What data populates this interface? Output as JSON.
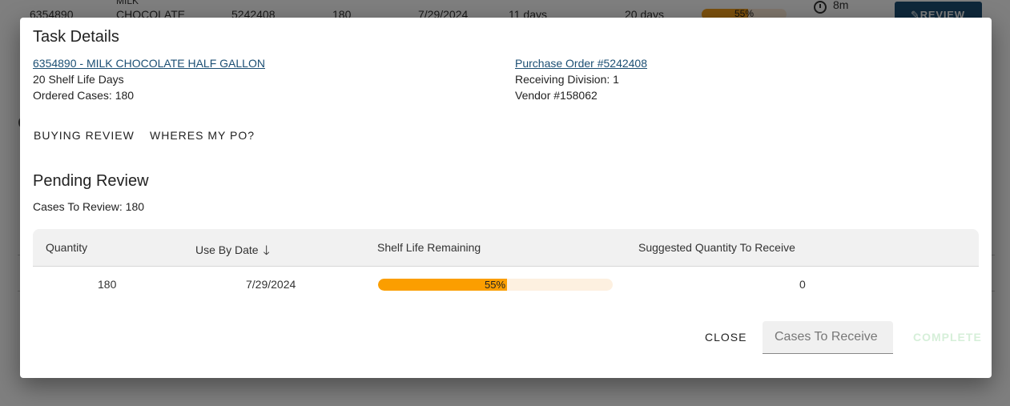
{
  "background": {
    "row": {
      "item_number": "6354890",
      "item_name_top": "MILK",
      "item_name": "CHOCOLATE",
      "po_number": "5242408",
      "cases": "180",
      "use_by_date": "7/29/2024",
      "days_remaining": "11 days",
      "shelf_life": "20 days",
      "shelf_life_percent_label": "55%",
      "shelf_life_fraction": 0.55,
      "timer": "8m",
      "review_label": "REVIEW"
    },
    "partial_letter": "C"
  },
  "dialog": {
    "title": "Task Details",
    "item_link": "6354890 - MILK CHOCOLATE HALF GALLON",
    "shelf_life_days": "20 Shelf Life Days",
    "ordered_cases": "Ordered Cases: 180",
    "po_link": "Purchase Order #5242408",
    "receiving_division": "Receiving Division: 1",
    "vendor": "Vendor #158062",
    "tabs": [
      "BUYING REVIEW",
      "WHERES MY PO?"
    ],
    "section_title": "Pending Review",
    "cases_to_review": "Cases To Review: 180",
    "table": {
      "headers": {
        "quantity": "Quantity",
        "use_by_date": "Use By Date",
        "shelf_life_remaining": "Shelf Life Remaining",
        "suggested_quantity": "Suggested Quantity To Receive"
      },
      "rows": [
        {
          "quantity": "180",
          "use_by_date": "7/29/2024",
          "shelf_life_label": "55%",
          "shelf_life_fraction": 0.55,
          "suggested_quantity": "0"
        }
      ]
    },
    "close_label": "CLOSE",
    "cases_input_placeholder": "Cases To Receive",
    "cases_input_value": "",
    "complete_label": "COMPLETE"
  },
  "colors": {
    "accent": "#1c4f74",
    "progress_fill": "#fb9e00",
    "progress_track": "#fdf0e0",
    "complete_disabled": "#d6efd9"
  },
  "icons": {
    "sort": "arrow-down-icon",
    "timer": "clock-icon",
    "edit": "pencil-icon"
  }
}
